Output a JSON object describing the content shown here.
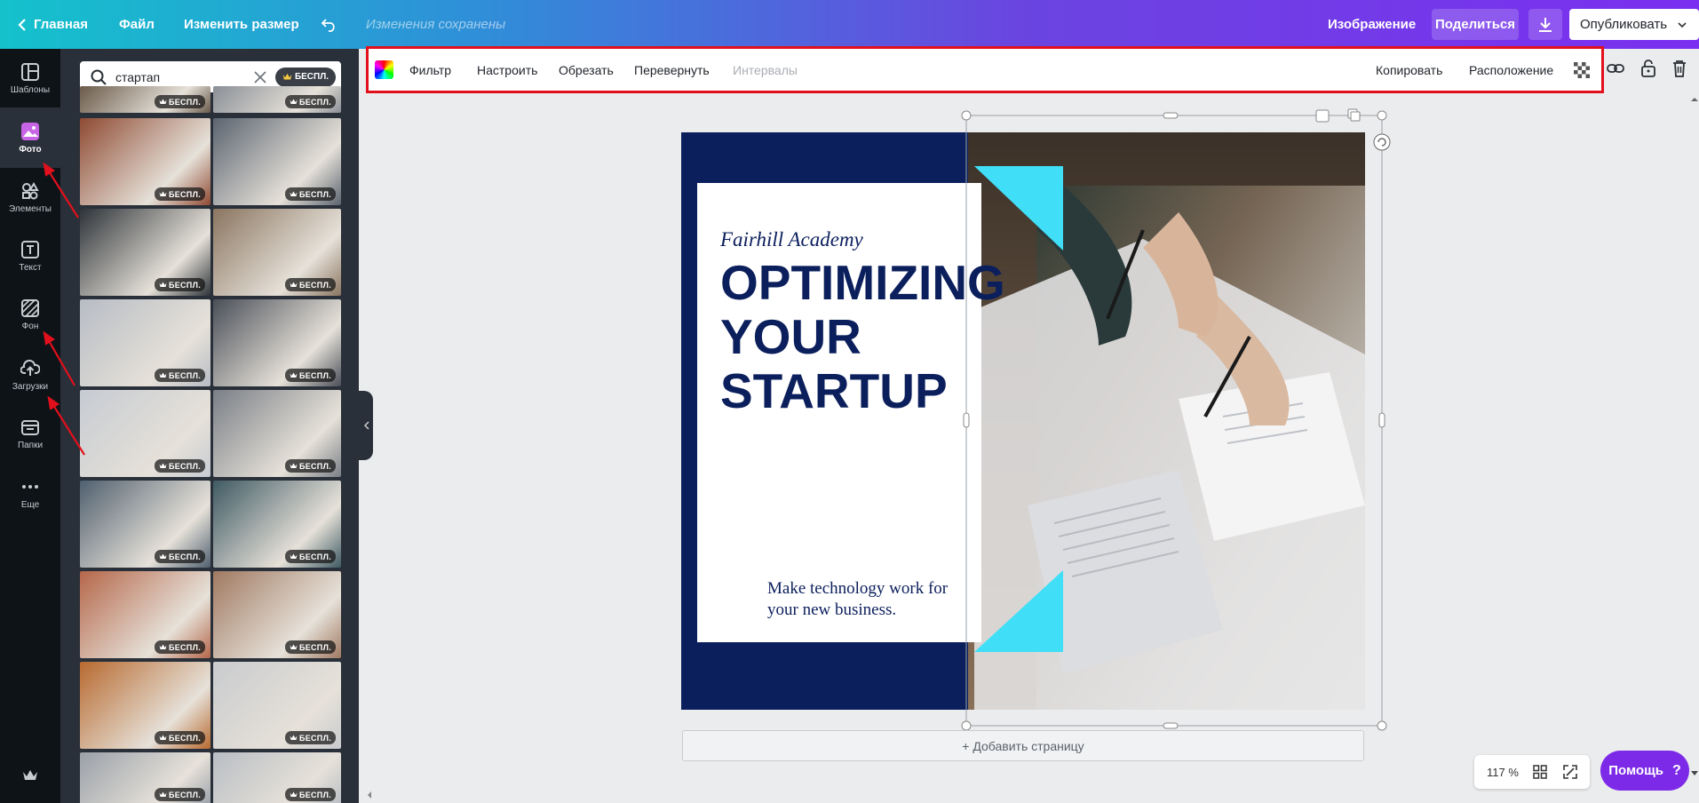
{
  "topbar": {
    "home_label": "Главная",
    "file_label": "Файл",
    "resize_label": "Изменить размер",
    "saved_status": "Изменения сохранены",
    "image_label": "Изображение",
    "share_label": "Поделиться",
    "publish_label": "Опубликовать",
    "gradient_colors": [
      "#14c2cc",
      "#6a45e0",
      "#7b2ff0"
    ]
  },
  "sidebar": {
    "items": [
      {
        "label": "Шаблоны",
        "icon": "templates-icon"
      },
      {
        "label": "Фото",
        "icon": "photo-icon",
        "active": true
      },
      {
        "label": "Элементы",
        "icon": "elements-icon"
      },
      {
        "label": "Текст",
        "icon": "text-icon"
      },
      {
        "label": "Фон",
        "icon": "background-icon"
      },
      {
        "label": "Загрузки",
        "icon": "upload-icon"
      },
      {
        "label": "Папки",
        "icon": "folder-icon"
      },
      {
        "label": "Еще",
        "icon": "more-icon"
      }
    ],
    "accent": "#c864e6"
  },
  "photos_panel": {
    "search_value": "стартап",
    "search_badge": "БЕСПЛ.",
    "badge_label": "БЕСПЛ."
  },
  "toolbar": {
    "filter": "Фильтр",
    "adjust": "Настроить",
    "crop": "Обрезать",
    "flip": "Перевернуть",
    "spacing": "Интервалы",
    "copy": "Копировать",
    "position": "Расположение"
  },
  "design": {
    "academy": "Fairhill Academy",
    "headline_1": "OPTIMIZING",
    "headline_2": "YOUR",
    "headline_3": "STARTUP",
    "tagline_1": "Make technology work for",
    "tagline_2": "your new business.",
    "navy": "#0b1f5c",
    "cyan": "#40dff7"
  },
  "add_page": "+ Добавить страницу",
  "zoom": "117 %",
  "help": "Помощь",
  "help_icon": "?",
  "annotation_color": "#e2101c"
}
